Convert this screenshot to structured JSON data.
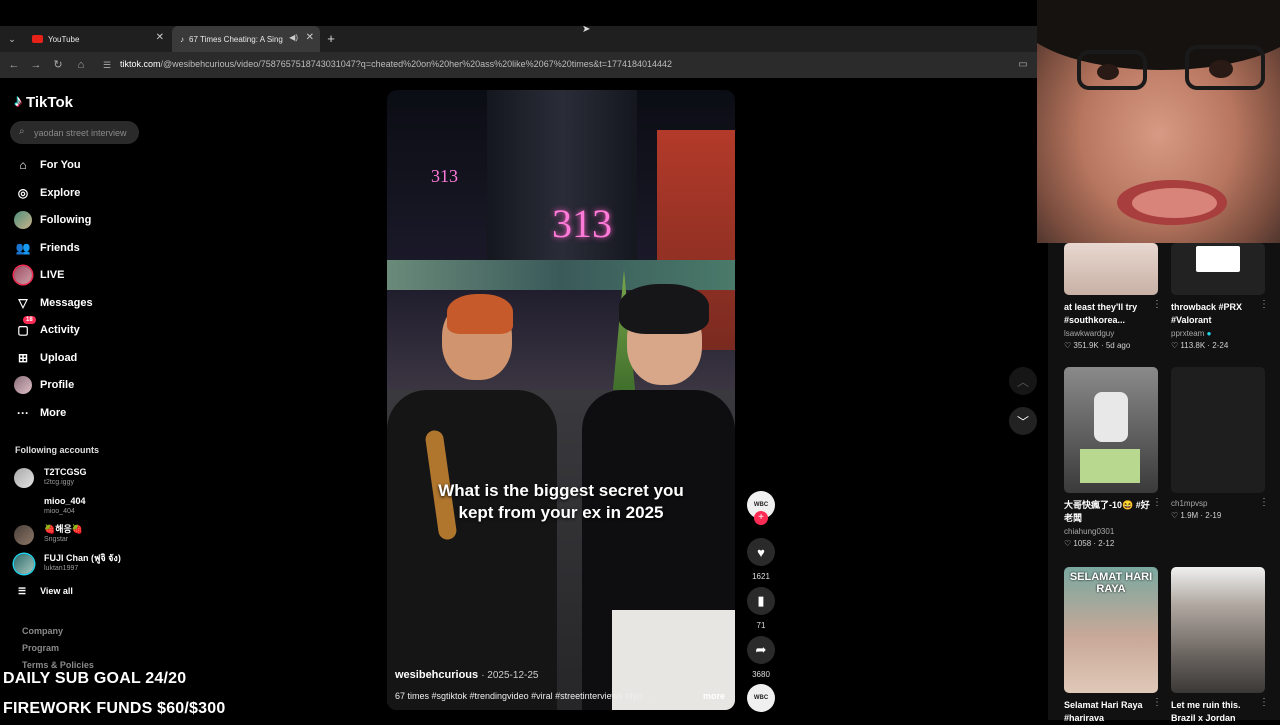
{
  "browser": {
    "tabs": [
      {
        "title": "YouTube",
        "active": false
      },
      {
        "title": "67 Times Cheating: A Sing",
        "active": true
      }
    ],
    "url_domain": "tiktok.com",
    "url_path": "/@wesibehcurious/video/7587657518743031047?q=cheated%20on%20her%20ass%20like%2067%20times&t=1774184014442"
  },
  "sidebar": {
    "logo": "TikTok",
    "search_placeholder": "yaodan street interview",
    "nav": [
      {
        "label": "For You",
        "icon": "home-icon"
      },
      {
        "label": "Explore",
        "icon": "compass-icon"
      },
      {
        "label": "Following",
        "icon": "avatar-icon"
      },
      {
        "label": "Friends",
        "icon": "friends-icon"
      },
      {
        "label": "LIVE",
        "icon": "live-avatar-icon"
      },
      {
        "label": "Messages",
        "icon": "messages-icon"
      },
      {
        "label": "Activity",
        "icon": "activity-icon",
        "badge": "18"
      },
      {
        "label": "Upload",
        "icon": "upload-icon"
      },
      {
        "label": "Profile",
        "icon": "profile-icon"
      },
      {
        "label": "More",
        "icon": "more-icon"
      }
    ],
    "following_title": "Following accounts",
    "accounts": [
      {
        "name": "T2TCGSG",
        "handle": "t2tcg.iggy"
      },
      {
        "name": "mioo_404",
        "handle": "mioo_404"
      },
      {
        "name": "🍓해응🍓",
        "handle": "Sngstar"
      },
      {
        "name": "FUJI Chan (ฟูจิ จัง)",
        "handle": "luktan1997"
      }
    ],
    "view_all": "View all",
    "footer": [
      "Company",
      "Program",
      "Terms & Policies"
    ]
  },
  "overlay": {
    "line1": "DAILY SUB GOAL 24/20",
    "line2": "FIREWORK FUNDS $60/$300"
  },
  "video": {
    "sign_text": "313",
    "sign_small": "313",
    "caption_line1": "What is the biggest secret you",
    "caption_line2": "kept from your ex in 2025",
    "author": "wesibehcurious",
    "date": "· 2025-12-25",
    "description": "67 times #sgtiktok #trendingvideo #viral #streetinterviews #fyp ...",
    "more": "more"
  },
  "actions": {
    "likes": "1621",
    "saves": "71",
    "shares": "3680"
  },
  "grid": [
    {
      "title": "at least they'll try #southkorea...",
      "author": "lsawkwardguy",
      "stats": "♡ 351.9K · 5d ago"
    },
    {
      "title": "throwback #PRX #Valorant",
      "author": "pprxteam",
      "verified": true,
      "stats": "♡ 113.8K · 2-24"
    },
    {
      "title": "大哥快瘋了-10😆 #好老闆",
      "author": "chiahung0301",
      "stats": "♡ 1058 · 2-12"
    },
    {
      "title": "",
      "author": "ch1mpvsp",
      "stats": "♡ 1.9M · 2-19"
    },
    {
      "title": "Selamat Hari Raya #harirava",
      "author": "",
      "stats": "",
      "thumb_text": "SELAMAT HARI RAYA"
    },
    {
      "title": "Let me ruin this. Brazil x Jordan",
      "author": "",
      "stats": ""
    }
  ],
  "colors": {
    "accent": "#fe2c55",
    "bg": "#000000",
    "panel": "#2a2a2a"
  }
}
